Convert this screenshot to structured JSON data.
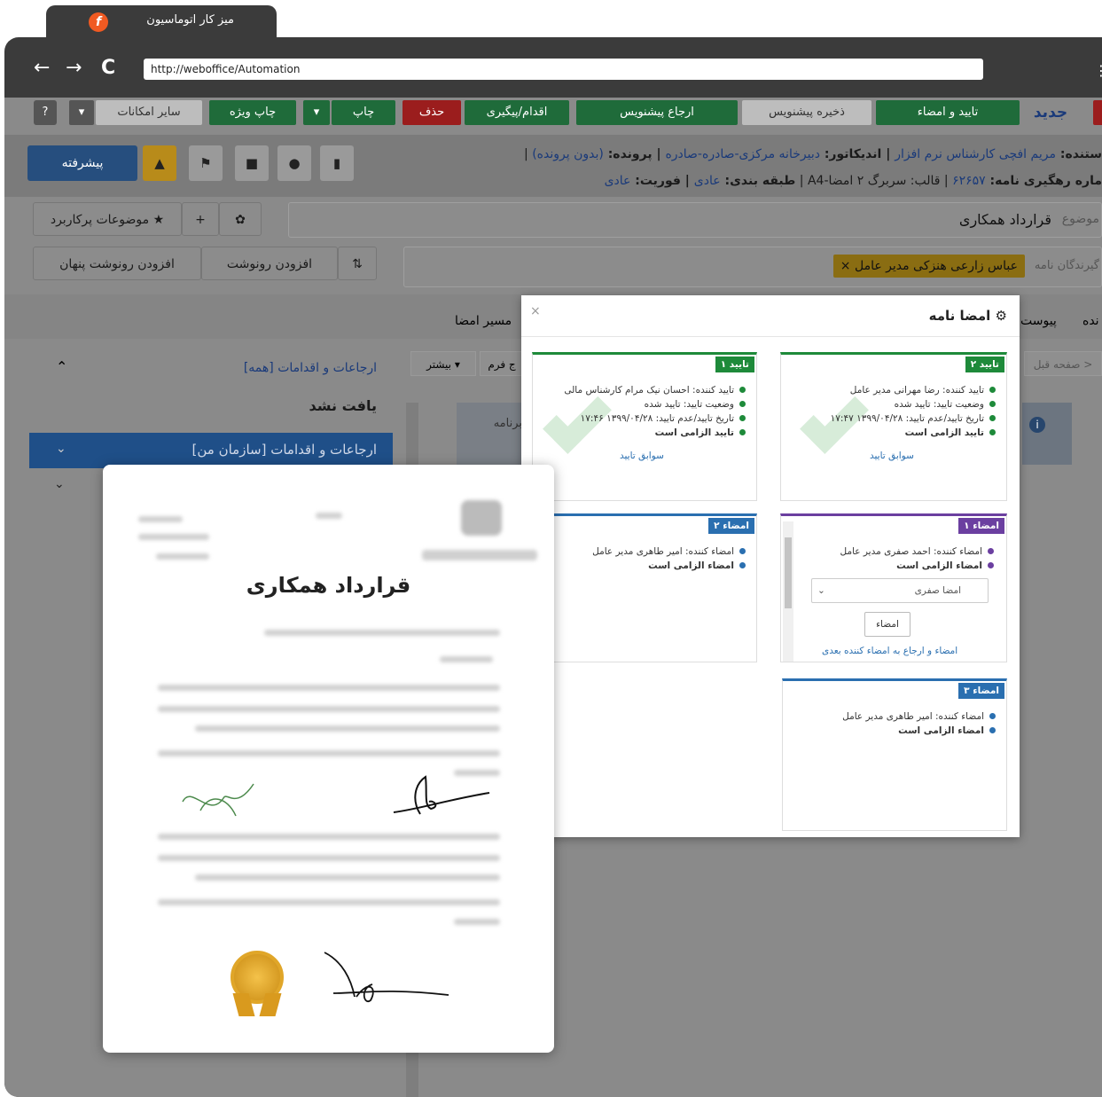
{
  "browser": {
    "tab_title": "میز کار اتوماسیون",
    "logo_letter": "f",
    "url": "http://weboffice/Automation",
    "back": "←",
    "forward": "→",
    "reload": "C",
    "menu": "⋮"
  },
  "toolbar": {
    "new": "جدید",
    "approve_sign": "تایید و امضاء",
    "save_draft": "ذخیره پیشنویس",
    "refer_draft": "ارجاع پیشنویس",
    "action": "اقدام/پیگیری",
    "delete": "حذف",
    "print": "چاپ",
    "special_print": "چاپ ویژه",
    "other": "سایر امکانات",
    "help_icon": "?"
  },
  "info": {
    "line1_a": "ستنده: ",
    "line1_b": "مریم افچی کارشناس نرم افزار",
    "line1_c": " | اندیکاتور: ",
    "line1_d": "دبیرخانه مرکزی-صادره-صادره",
    "line1_e": " | پرونده: ",
    "line1_f": "(بدون پرونده)",
    "line1_g": " |",
    "line2_a": "ماره رهگیری نامه: ",
    "line2_b": "۶۲۶۵۷",
    "line2_c": " | قالب: سربرگ ۲ امضا-A4 | ",
    "line2_d": "طبقه بندی: ",
    "line2_e": "عادی",
    "line2_f": " | فوریت: ",
    "line2_g": "عادی",
    "advanced": "پیشرفته"
  },
  "subject": {
    "label": "موضوع",
    "value": "قرارداد همکاری",
    "frequent": "موضوعات پرکاربرد",
    "plus": "+"
  },
  "recipients": {
    "label": "گیرندگان نامه",
    "person": "عباس زارعی هنزکی مدیر عامل",
    "add_copy": "افزودن رونوشت",
    "add_hidden": "افزودن رونوشت پنهان"
  },
  "tabs": {
    "t1": "ندە",
    "t2": "پیوست",
    "t3": "مسیر امضا",
    "prev": "< صفحه قبل",
    "more": "بیشتر",
    "form": "ج فرم",
    "program": "برنامه"
  },
  "side": {
    "h1": "ارجاعات و اقدامات [همه]",
    "empty": "یافت نشد",
    "h2": "ارجاعات و اقدامات [سازمان من]"
  },
  "modal": {
    "title": "امضا نامه",
    "close": "×",
    "c1": {
      "tag": "تایید ۲",
      "l1": "تایید کننده: رضا مهرانی مدیر عامل",
      "l2": "وضعیت تایید: تایید شده",
      "l3": "تاریخ تایید/عدم تایید: ۱۳۹۹/۰۴/۲۸ ۱۷:۴۷",
      "l4": "تایید الزامی است",
      "link": "سوابق تایید"
    },
    "c2": {
      "tag": "تایید ۱",
      "l1": "تایید کننده: احسان نیک مرام کارشناس مالی",
      "l2": "وضعیت تایید: تایید شده",
      "l3": "تاریخ تایید/عدم تایید: ۱۳۹۹/۰۴/۲۸ ۱۷:۴۶",
      "l4": "تایید الزامی است",
      "link": "سوابق تایید"
    },
    "c3": {
      "tag": "امضاء ۱",
      "l1": "امضاء کننده: احمد صفری مدیر عامل",
      "l2": "امضاء الزامی است",
      "select": "امضا صفری",
      "btn": "امضاء",
      "link": "امضاء و ارجاع به امضاء کننده بعدی"
    },
    "c4": {
      "tag": "امضاء ۲",
      "l1": "امضاء کننده: امیر طاهری مدیر عامل",
      "l2": "امضاء الزامی است"
    },
    "c5": {
      "tag": "امضاء ۳",
      "l1": "امضاء کننده: امیر طاهری مدیر عامل",
      "l2": "امضاء الزامی است"
    }
  },
  "doc": {
    "title": "قرارداد همکاری"
  },
  "colors": {
    "green": "#1e8a3a",
    "blue": "#2a6fb0",
    "purple": "#6b3fa0",
    "accent": "#f05a22"
  }
}
